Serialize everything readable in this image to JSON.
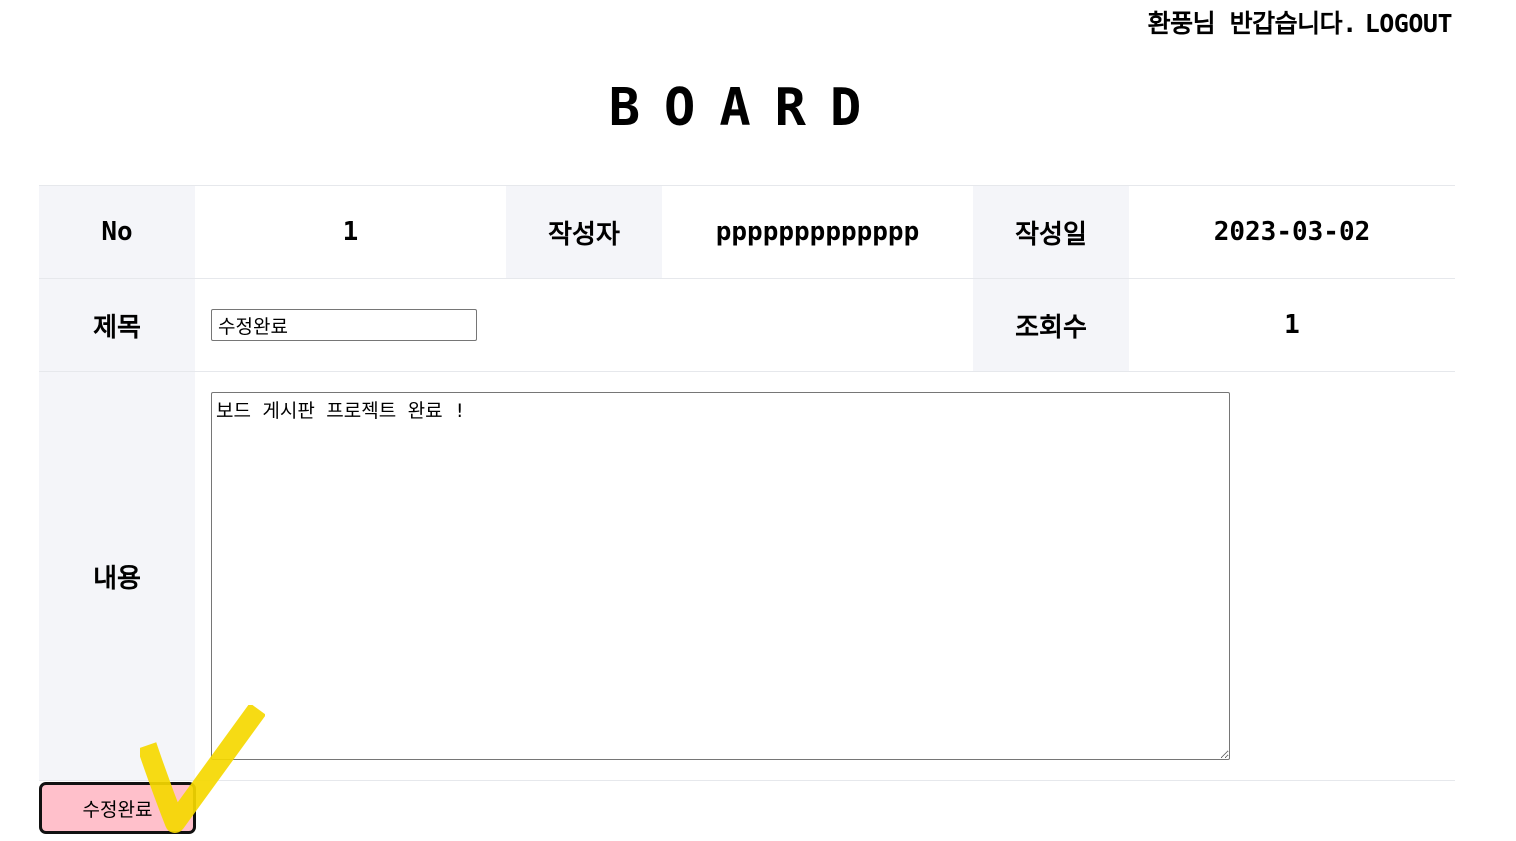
{
  "header": {
    "greeting": "환풍님 반갑습니다.",
    "logout_label": "LOGOUT"
  },
  "page_title": "BOARD",
  "post": {
    "no_label": "No",
    "no_value": "1",
    "author_label": "작성자",
    "author_value": "ppppppppppppp",
    "date_label": "작성일",
    "date_value": "2023-03-02",
    "subject_label": "제목",
    "subject_value": "수정완료",
    "views_label": "조회수",
    "views_value": "1",
    "content_label": "내용",
    "content_value": "보드 게시판 프로젝트 완료 !"
  },
  "actions": {
    "submit_label": "수정완료"
  },
  "colors": {
    "header_cell_bg": "#f4f5f9",
    "button_bg": "#ffc0cb",
    "checkmark": "#f5d800"
  }
}
